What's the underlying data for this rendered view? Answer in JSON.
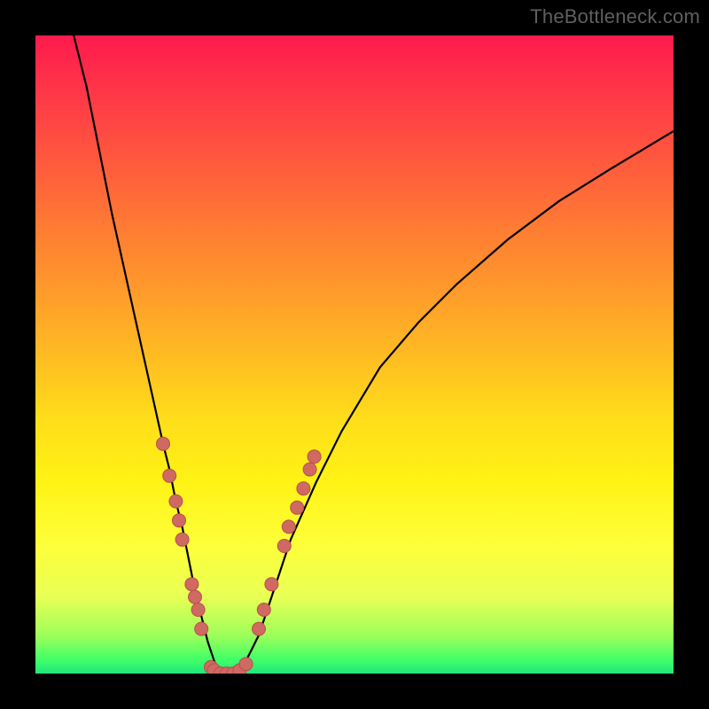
{
  "attribution": "TheBottleneck.com",
  "colors": {
    "frame": "#000000",
    "gradient_top": "#ff1a4d",
    "gradient_mid": "#ffdd1a",
    "gradient_bottom": "#22e57a",
    "curve": "#000000",
    "marker_fill": "#cf6a63",
    "marker_stroke": "#b94f49"
  },
  "chart_data": {
    "type": "line",
    "title": "",
    "xlabel": "",
    "ylabel": "",
    "xlim": [
      0,
      100
    ],
    "ylim": [
      0,
      100
    ],
    "grid": false,
    "legend": false,
    "series": [
      {
        "name": "curve",
        "x": [
          6,
          8,
          10,
          12,
          14,
          16,
          18,
          20,
          21,
          22,
          23,
          24,
          25,
          26,
          27,
          28,
          29,
          30,
          31,
          32,
          33,
          35,
          37,
          40,
          44,
          48,
          54,
          60,
          66,
          74,
          82,
          90,
          100
        ],
        "y": [
          100,
          92,
          82,
          72,
          63,
          54,
          45,
          36,
          32,
          27,
          23,
          18,
          13,
          9,
          5,
          2,
          0,
          0,
          0,
          0,
          2,
          6,
          12,
          21,
          30,
          38,
          48,
          55,
          61,
          68,
          74,
          79,
          85
        ]
      }
    ],
    "markers": [
      {
        "x": 20,
        "y": 36
      },
      {
        "x": 21,
        "y": 31
      },
      {
        "x": 22,
        "y": 27
      },
      {
        "x": 22.5,
        "y": 24
      },
      {
        "x": 23,
        "y": 21
      },
      {
        "x": 24.5,
        "y": 14
      },
      {
        "x": 25,
        "y": 12
      },
      {
        "x": 25.5,
        "y": 10
      },
      {
        "x": 26,
        "y": 7
      },
      {
        "x": 27.5,
        "y": 1
      },
      {
        "x": 28,
        "y": 0.5
      },
      {
        "x": 29,
        "y": 0
      },
      {
        "x": 30,
        "y": 0
      },
      {
        "x": 31,
        "y": 0
      },
      {
        "x": 32,
        "y": 0.5
      },
      {
        "x": 33,
        "y": 1.5
      },
      {
        "x": 35,
        "y": 7
      },
      {
        "x": 35.8,
        "y": 10
      },
      {
        "x": 37,
        "y": 14
      },
      {
        "x": 39,
        "y": 20
      },
      {
        "x": 39.7,
        "y": 23
      },
      {
        "x": 41,
        "y": 26
      },
      {
        "x": 42,
        "y": 29
      },
      {
        "x": 43,
        "y": 32
      },
      {
        "x": 43.7,
        "y": 34
      }
    ]
  }
}
